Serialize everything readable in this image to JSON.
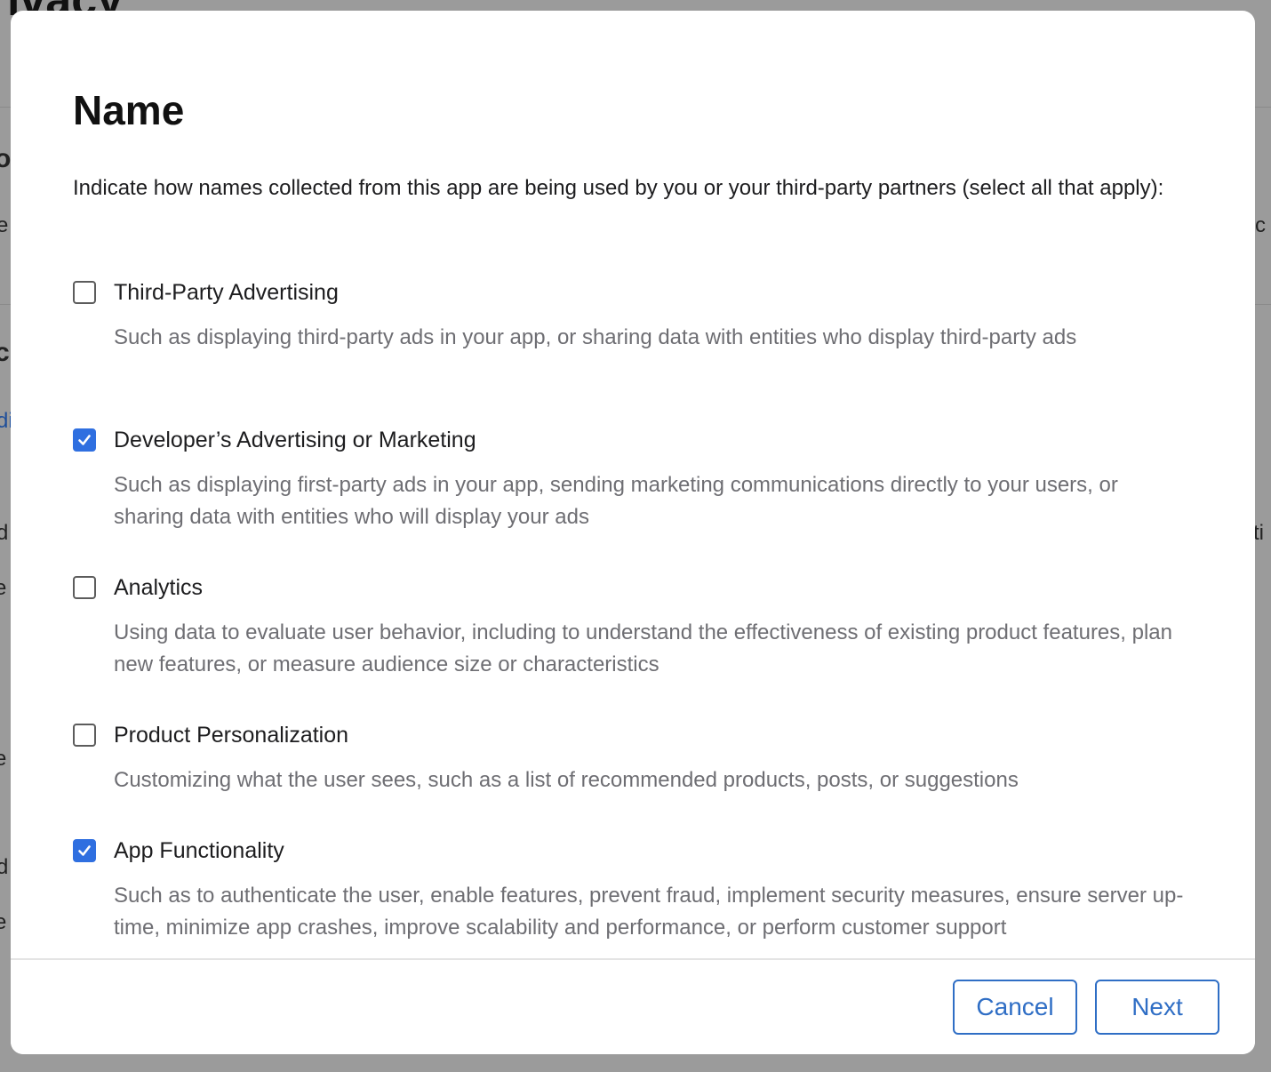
{
  "background": {
    "page_title_fragment": "ivacy",
    "fragments": [
      "o",
      "e",
      "c",
      "di",
      "d",
      "e",
      "e",
      "d",
      "e",
      "c",
      "ti"
    ]
  },
  "modal": {
    "title": "Name",
    "intro": "Indicate how names collected from this app are being used by you or your third-party partners (select all that apply):",
    "options": [
      {
        "label": "Third-Party Advertising",
        "description": "Such as displaying third-party ads in your app, or sharing data with entities who display third-party ads",
        "checked": false
      },
      {
        "label": "Developer’s Advertising or Marketing",
        "description": "Such as displaying first-party ads in your app, sending marketing communications directly to your users, or sharing data with entities who will display your ads",
        "checked": true
      },
      {
        "label": "Analytics",
        "description": "Using data to evaluate user behavior, including to understand the effectiveness of existing product features, plan new features, or measure audience size or characteristics",
        "checked": false
      },
      {
        "label": "Product Personalization",
        "description": "Customizing what the user sees, such as a list of recommended products, posts, or suggestions",
        "checked": false
      },
      {
        "label": "App Functionality",
        "description": "Such as to authenticate the user, enable features, prevent fraud, implement security measures, ensure server up-time, minimize app crashes, improve scalability and performance, or perform customer support",
        "checked": true
      }
    ],
    "footer": {
      "cancel_label": "Cancel",
      "next_label": "Next"
    }
  },
  "colors": {
    "accent": "#2f6ec5",
    "checkbox_checked": "#2f6fe0",
    "overlay": "#9b9b9b"
  }
}
